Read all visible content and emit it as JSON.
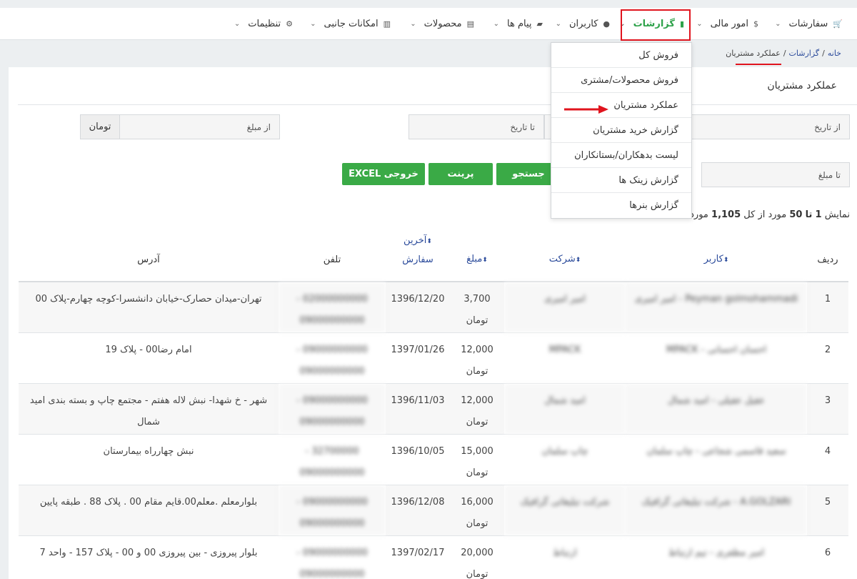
{
  "nav": {
    "items": [
      {
        "label": "سفارشات",
        "icon": "cart-icon",
        "glyph": "🛒"
      },
      {
        "label": "امور مالی",
        "icon": "dollar-icon",
        "glyph": "$"
      },
      {
        "label": "گزارشات",
        "icon": "report-icon",
        "glyph": "▮"
      },
      {
        "label": "کاربران",
        "icon": "user-icon",
        "glyph": "●"
      },
      {
        "label": "پیام ها",
        "icon": "message-icon",
        "glyph": "▰"
      },
      {
        "label": "محصولات",
        "icon": "product-icon",
        "glyph": "▤"
      },
      {
        "label": "امکانات جانبی",
        "icon": "grid-icon",
        "glyph": "▥"
      },
      {
        "label": "تنظیمات",
        "icon": "gear-icon",
        "glyph": "⚙"
      }
    ]
  },
  "breadcrumb": {
    "home": "خانه",
    "reports": "گزارشات",
    "current": "عملکرد مشتریان",
    "sep": "/"
  },
  "panel": {
    "title": "عملکرد مشتریان"
  },
  "filters": {
    "from_date": "از تاریخ",
    "to_date": "تا تاریخ",
    "from_amount": "از مبلغ",
    "to_amount": "تا مبلغ",
    "currency": "تومان"
  },
  "buttons": {
    "search": "جستجو",
    "print": "پرینت",
    "excel": "خروجی EXCEL"
  },
  "summary": {
    "prefix": "نمایش",
    "from": "1",
    "to_word": "تا",
    "to": "50",
    "mid": "مورد از کل",
    "total": "1,105",
    "suffix": "مورد."
  },
  "table": {
    "headers": {
      "row": "ردیف",
      "user": "کاربر",
      "company": "شرکت",
      "amount": "مبلغ",
      "last_order_1": "آخرین",
      "last_order_2": "سفارش",
      "phone": "تلفن",
      "address": "آدرس"
    },
    "rows": [
      {
        "n": "1",
        "user": "Peyman golmohammadi - امیر امیری",
        "company": "امیر امیری",
        "amount": "3,700",
        "unit": "تومان",
        "date": "1396/12/20",
        "phone": "02000000000 - 09000000000",
        "address": "تهران-میدان حصارک-خیابان دانشسرا-کوچه چهارم-پلاک 00"
      },
      {
        "n": "2",
        "user": "احسان احسانی - MPACK",
        "company": "MPACK",
        "amount": "12,000",
        "unit": "تومان",
        "date": "1397/01/26",
        "phone": "09000000000 - 09000000000",
        "address": "امام رضا00 - پلاک 19"
      },
      {
        "n": "3",
        "user": "عقیل عقیلی - امید شمال",
        "company": "امید شمال",
        "amount": "12,000",
        "unit": "تومان",
        "date": "1396/11/03",
        "phone": "09000000000 - 09000000000",
        "address": "شهر - خ شهدا- نبش لاله هفتم - مجتمع چاپ و بسته بندی امید شمال"
      },
      {
        "n": "4",
        "user": "سعید قاسمی شجاعی - چاپ سلمان",
        "company": "چاپ سلمان",
        "amount": "15,000",
        "unit": "تومان",
        "date": "1396/10/05",
        "phone": "32700000 - 09000000000",
        "address": "نبش چهارراه بیمارستان"
      },
      {
        "n": "5",
        "user": "A.GOLZARI - شرکت تبلیغاتی گرافیک",
        "company": "شرکت تبلیغاتی گرافیک",
        "amount": "16,000",
        "unit": "تومان",
        "date": "1396/12/08",
        "phone": "09000000000 - 09000000000",
        "address": "بلوارمعلم .معلم00.قایم مقام 00 . پلاک 88 . طبقه پایین"
      },
      {
        "n": "6",
        "user": "امیر مظفری - تیم ارتباط",
        "company": "ارتباط",
        "amount": "20,000",
        "unit": "تومان",
        "date": "1397/02/17",
        "phone": "09000000000 - 09000000000",
        "address": "بلوار پیروزی - بین پیروزی 00 و 00 - پلاک 157 - واحد 7"
      }
    ]
  },
  "dropdown": {
    "items": [
      "فروش کل",
      "فروش محصولات/مشتری",
      "عملکرد مشتریان",
      "گزارش خرید مشتریان",
      "لیست بدهکاران/بستانکاران",
      "گزارش زینک ها",
      "گزارش بنرها"
    ]
  },
  "colors": {
    "accent_green": "#3aaa46",
    "highlight_red": "#e0141e",
    "link_blue": "#2b4b9b"
  }
}
